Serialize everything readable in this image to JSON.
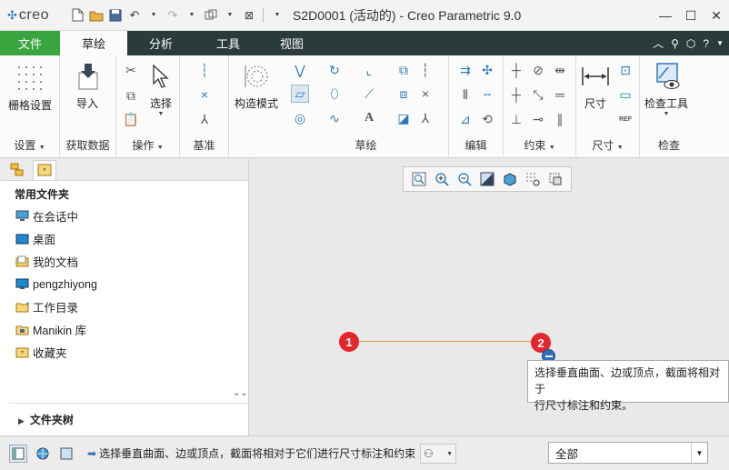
{
  "app": {
    "logo_text": "creo",
    "window_title": "S2D0001 (活动的) - Creo Parametric 9.0"
  },
  "tabs": [
    {
      "label": "文件"
    },
    {
      "label": "草绘"
    },
    {
      "label": "分析"
    },
    {
      "label": "工具"
    },
    {
      "label": "视图"
    }
  ],
  "ribbon": {
    "setup": {
      "button": "栅格设置",
      "group": "设置"
    },
    "get_data": {
      "button": "导入",
      "group": "获取数据"
    },
    "operations": {
      "button": "选择",
      "group": "操作"
    },
    "datum": {
      "group": "基准"
    },
    "construction": {
      "button": "构造模式"
    },
    "sketching": {
      "group": "草绘",
      "text_icon": "A"
    },
    "editing": {
      "group": "编辑"
    },
    "constrain": {
      "group": "约束"
    },
    "dimension": {
      "button": "尺寸",
      "group": "尺寸",
      "ref_icon": "REF"
    },
    "inspect": {
      "button": "检查工具",
      "group": "检查"
    }
  },
  "navigator": {
    "section_title": "常用文件夹",
    "items": [
      {
        "label": "在会话中",
        "icon": "monitor-icon"
      },
      {
        "label": "桌面",
        "icon": "desktop-icon"
      },
      {
        "label": "我的文档",
        "icon": "documents-icon"
      },
      {
        "label": "pengzhiyong",
        "icon": "computer-icon"
      },
      {
        "label": "工作目录",
        "icon": "working-folder-icon"
      },
      {
        "label": "Manikin 库",
        "icon": "library-icon"
      },
      {
        "label": "收藏夹",
        "icon": "favorites-icon"
      }
    ],
    "folder_tree_label": "文件夹树"
  },
  "canvas": {
    "point1": "1",
    "point2": "2",
    "tooltip_line1": "选择垂直曲面、边或顶点，截面将相对于",
    "tooltip_line2": "行尺寸标注和约束。"
  },
  "status": {
    "message": "选择垂直曲面、边或顶点，截面将相对于它们进行尺寸标注和约束",
    "filter_value": "全部"
  },
  "colors": {
    "file_tab": "#3aa53f",
    "tab_bar": "#2b3a3a",
    "accent_blue": "#2a7ab8",
    "point_red": "#e2262b",
    "sketch_line": "#d89b4a"
  }
}
